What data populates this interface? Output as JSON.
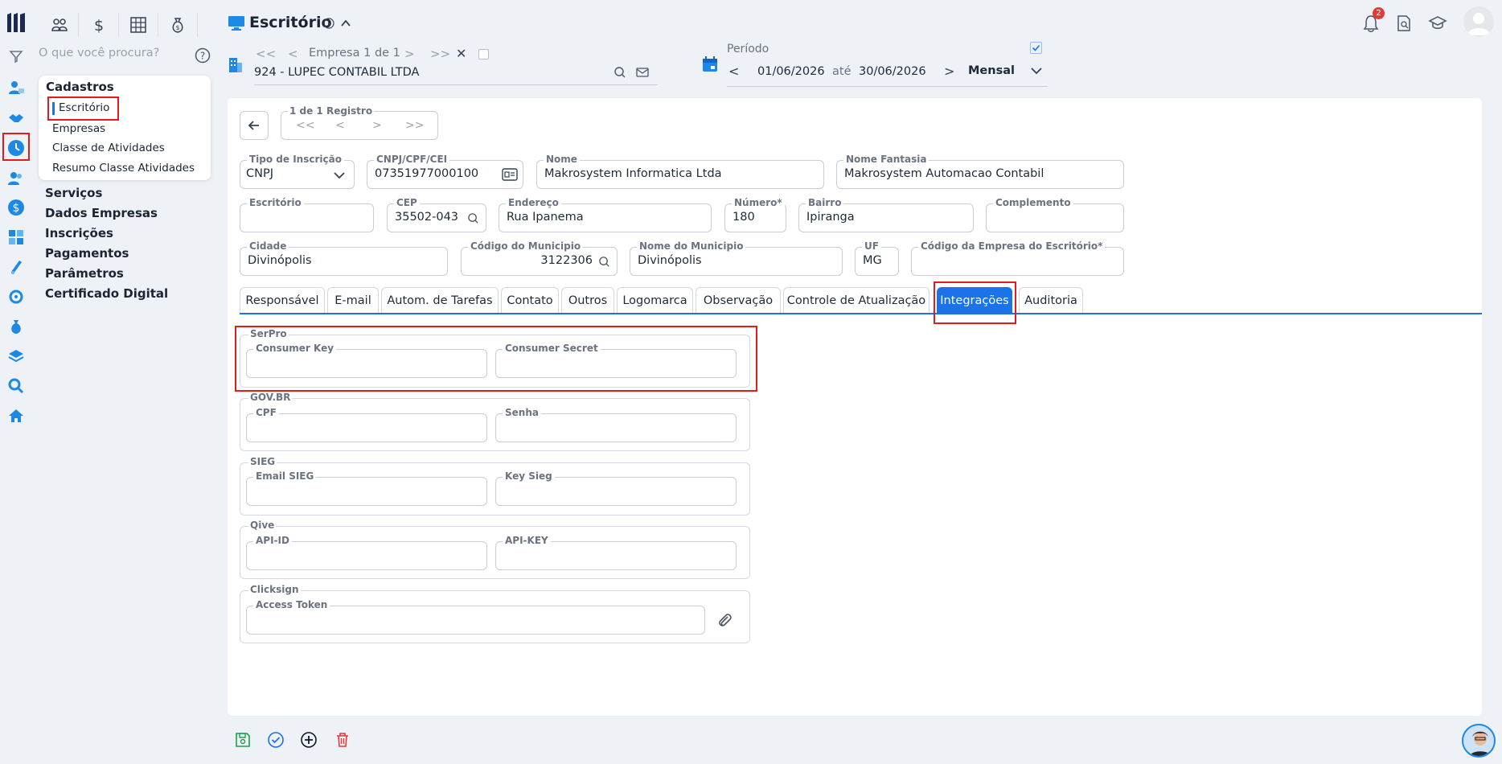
{
  "app": {
    "title": "Escritório"
  },
  "search": {
    "placeholder": "O que você procura?"
  },
  "notifications": {
    "count": "2"
  },
  "empresa_nav": {
    "label": "Empresa 1 de 1",
    "company": "924 - LUPEC CONTABIL LTDA"
  },
  "periodo": {
    "label": "Período",
    "from": "01/06/2026",
    "ate": "até",
    "to": "30/06/2026",
    "mode": "Mensal"
  },
  "menu": {
    "cadastros": "Cadastros",
    "cadastros_items": [
      "Escritório",
      "Empresas",
      "Classe de Atividades",
      "Resumo Classe Atividades"
    ],
    "sections": [
      "Serviços",
      "Dados Empresas",
      "Inscrições",
      "Pagamentos",
      "Parâmetros",
      "Certificado Digital"
    ]
  },
  "record_nav": {
    "label": "1 de 1 Registro"
  },
  "form": {
    "tipo_inscricao": {
      "label": "Tipo de Inscrição",
      "value": "CNPJ"
    },
    "cnpj": {
      "label": "CNPJ/CPF/CEI",
      "value": "07351977000100"
    },
    "nome": {
      "label": "Nome",
      "value": "Makrosystem Informatica Ltda"
    },
    "nome_fantasia": {
      "label": "Nome Fantasia",
      "value": "Makrosystem Automacao Contabil"
    },
    "escritorio": {
      "label": "Escritório",
      "value": ""
    },
    "cep": {
      "label": "CEP",
      "value": "35502-043"
    },
    "endereco": {
      "label": "Endereço",
      "value": "Rua Ipanema"
    },
    "numero": {
      "label": "Número*",
      "value": "180"
    },
    "bairro": {
      "label": "Bairro",
      "value": "Ipiranga"
    },
    "complemento": {
      "label": "Complemento",
      "value": ""
    },
    "cidade": {
      "label": "Cidade",
      "value": "Divinópolis"
    },
    "cod_municipio": {
      "label": "Código do Municipio",
      "value": "3122306"
    },
    "nome_municipio": {
      "label": "Nome do Municipio",
      "value": "Divinópolis"
    },
    "uf": {
      "label": "UF",
      "value": "MG"
    },
    "cod_empresa": {
      "label": "Código da Empresa do Escritório*",
      "value": ""
    }
  },
  "tabs": [
    "Responsável",
    "E-mail",
    "Autom. de Tarefas",
    "Contato",
    "Outros",
    "Logomarca",
    "Observação",
    "Controle de Atualização",
    "Integrações",
    "Auditoria"
  ],
  "active_tab": "Integrações",
  "integrations": {
    "serpro": {
      "title": "SerPro",
      "f1": "Consumer Key",
      "f2": "Consumer Secret"
    },
    "govbr": {
      "title": "GOV.BR",
      "f1": "CPF",
      "f2": "Senha"
    },
    "sieg": {
      "title": "SIEG",
      "f1": "Email SIEG",
      "f2": "Key Sieg"
    },
    "qive": {
      "title": "Qive",
      "f1": "API-ID",
      "f2": "API-KEY"
    },
    "clicksign": {
      "title": "Clicksign",
      "f1": "Access Token"
    }
  },
  "colors": {
    "accent": "#1a73e8",
    "highlight": "#e31b1b",
    "rail_icon": "#1e88e5"
  },
  "icons": [
    "logo",
    "users-icon",
    "dollar-icon",
    "calculator-icon",
    "money-bag-icon",
    "filter-icon",
    "help-icon",
    "bell-icon",
    "document-search-icon",
    "graduation-cap-icon",
    "avatar"
  ]
}
